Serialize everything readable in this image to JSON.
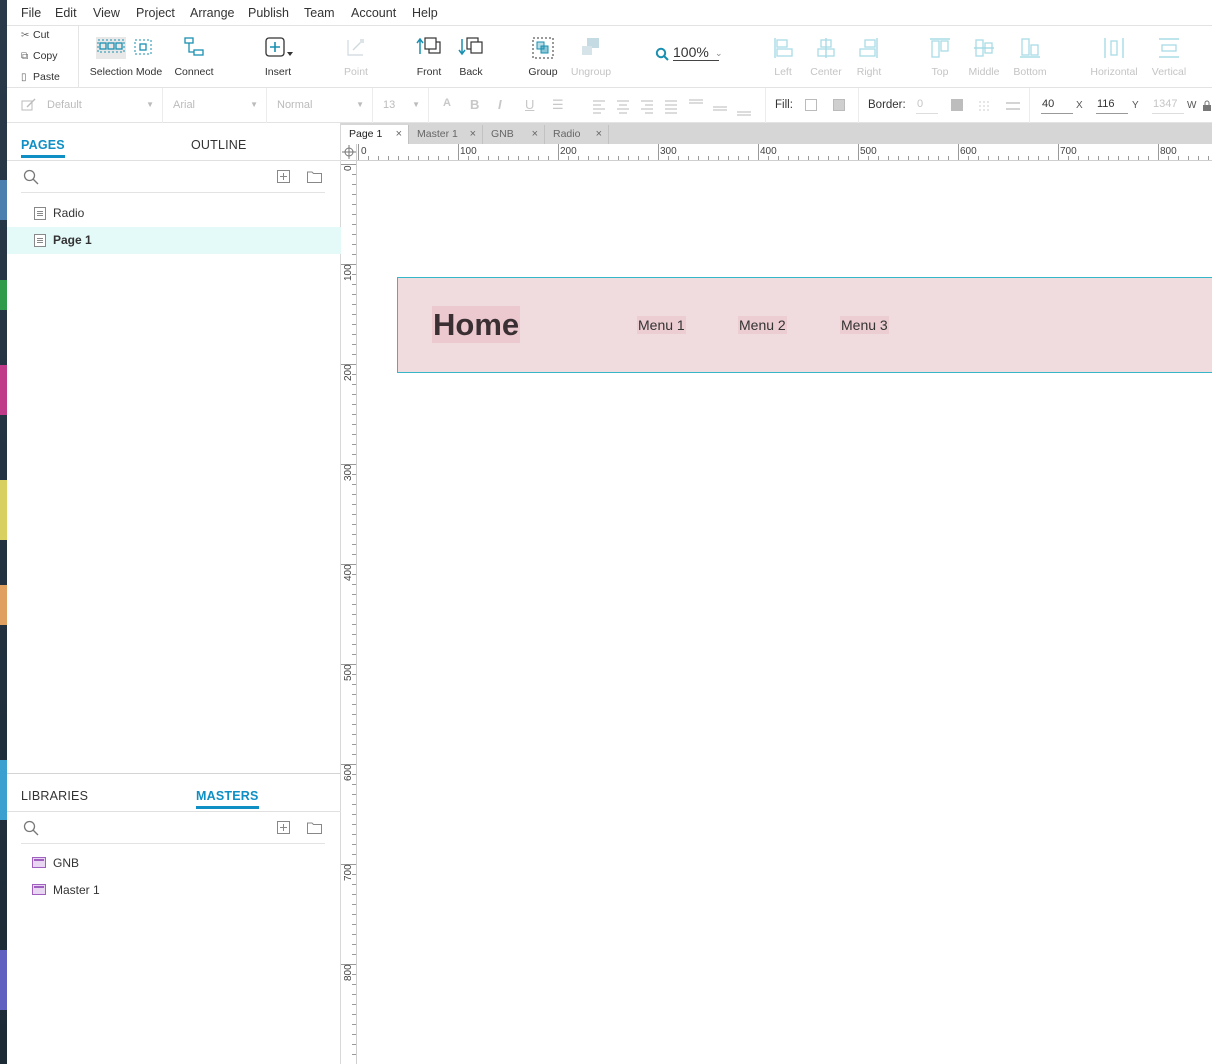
{
  "menubar": {
    "items": [
      "File",
      "Edit",
      "View",
      "Project",
      "Arrange",
      "Publish",
      "Team",
      "Account",
      "Help"
    ]
  },
  "toolbar": {
    "clipboard": {
      "cut": "Cut",
      "copy": "Copy",
      "paste": "Paste"
    },
    "selection_mode": "Selection Mode",
    "connect": "Connect",
    "insert": "Insert",
    "point": "Point",
    "front": "Front",
    "back": "Back",
    "group": "Group",
    "ungroup": "Ungroup",
    "zoom": "100%",
    "align": {
      "left": "Left",
      "center": "Center",
      "right": "Right",
      "top": "Top",
      "middle": "Middle",
      "bottom": "Bottom"
    },
    "distribute": {
      "horizontal": "Horizontal",
      "vertical": "Vertical"
    }
  },
  "format": {
    "style": "Default",
    "font": "Arial",
    "weight": "Normal",
    "size": "13",
    "fill_label": "Fill:",
    "border_label": "Border:",
    "border_value": "0",
    "x_value": "40",
    "x_label": "X",
    "y_value": "116",
    "y_label": "Y",
    "w_value": "1347",
    "w_label": "W"
  },
  "pages_panel": {
    "tabs": [
      "PAGES",
      "OUTLINE"
    ],
    "active_tab": "PAGES",
    "items": [
      {
        "label": "Radio",
        "selected": false
      },
      {
        "label": "Page 1",
        "selected": true
      }
    ]
  },
  "masters_panel": {
    "tabs": [
      "LIBRARIES",
      "MASTERS"
    ],
    "active_tab": "MASTERS",
    "items": [
      {
        "label": "GNB"
      },
      {
        "label": "Master 1"
      }
    ]
  },
  "doc_tabs": [
    {
      "label": "Page 1",
      "active": true
    },
    {
      "label": "Master 1",
      "active": false
    },
    {
      "label": "GNB",
      "active": false
    },
    {
      "label": "Radio",
      "active": false
    }
  ],
  "rulers": {
    "horizontal": [
      "0",
      "100",
      "200",
      "300",
      "400",
      "500",
      "600",
      "700",
      "800"
    ],
    "vertical": [
      "0",
      "100",
      "200",
      "300",
      "400",
      "500",
      "600",
      "700",
      "800"
    ]
  },
  "canvas": {
    "gnb": {
      "home": "Home",
      "menus": [
        "Menu 1",
        "Menu 2",
        "Menu 3"
      ]
    }
  },
  "colors": {
    "accent": "#0f8fc4",
    "selected_row": "#e4faf8",
    "gnb_bg": "#f0dcdf",
    "gnb_border": "#35b6c9"
  }
}
